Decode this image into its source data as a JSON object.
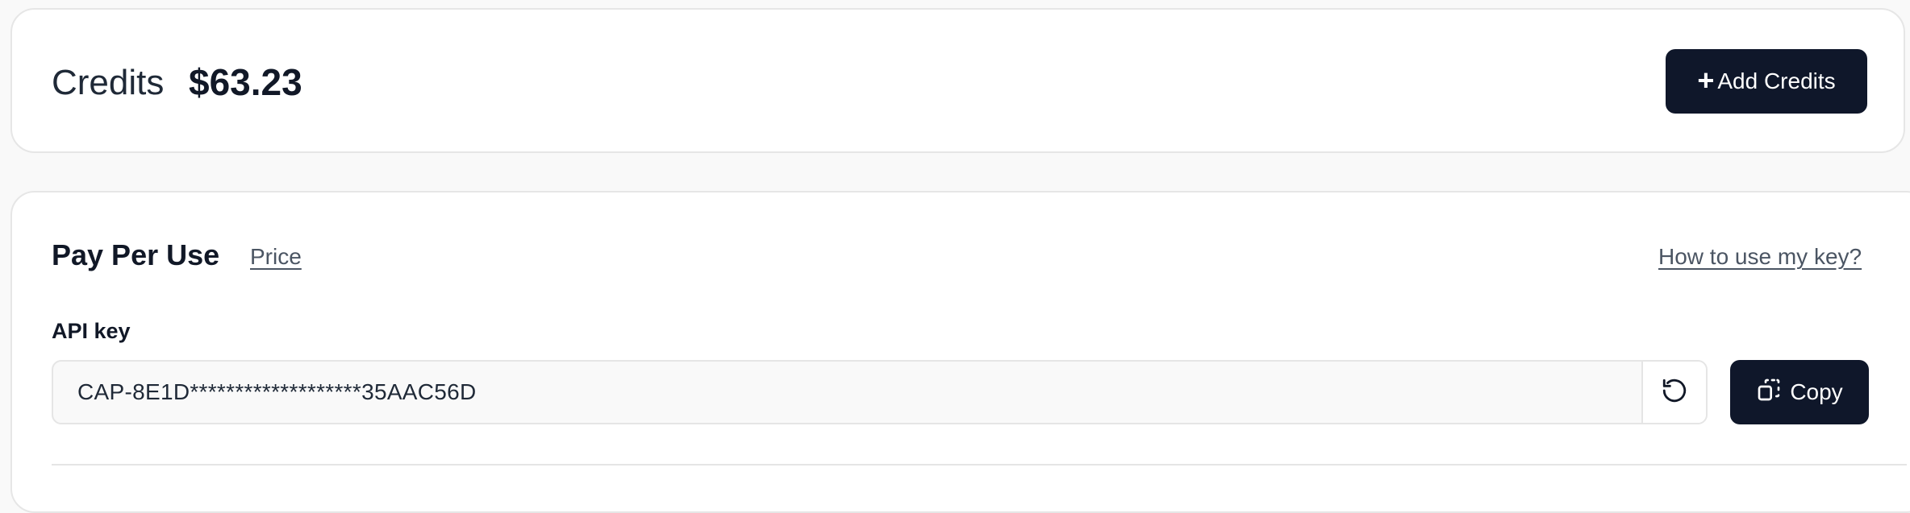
{
  "credits": {
    "label": "Credits",
    "amount": "$63.23",
    "add_button_icon": "+",
    "add_button_label": "Add Credits"
  },
  "pay_per_use": {
    "title": "Pay Per Use",
    "price_link": "Price",
    "help_link": "How to use my key?",
    "api_key_label": "API key",
    "api_key_value": "CAP-8E1D*******************35AAC56D",
    "copy_label": "Copy"
  },
  "icons": {
    "refresh": "refresh-icon",
    "copy": "copy-icon"
  },
  "colors": {
    "primary_button_bg": "#0f172a",
    "primary_button_text": "#ffffff",
    "page_bg": "#f9f9f9",
    "card_bg": "#ffffff",
    "link_text": "#4b5563"
  }
}
